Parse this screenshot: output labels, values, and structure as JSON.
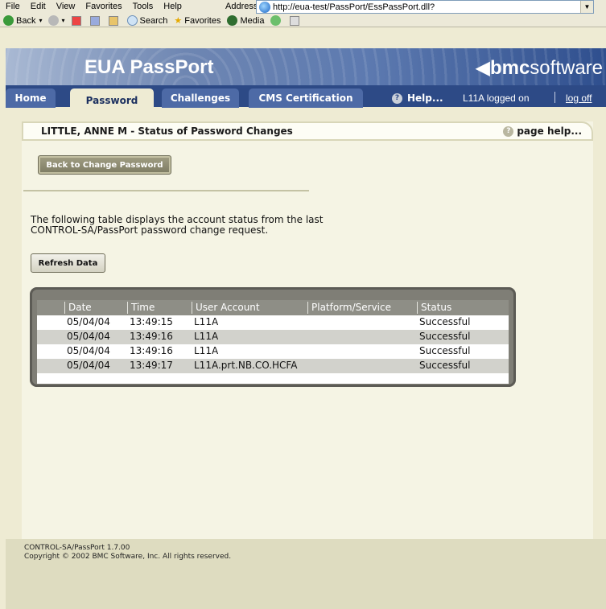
{
  "browser": {
    "menu": [
      "File",
      "Edit",
      "View",
      "Favorites",
      "Tools",
      "Help"
    ],
    "address_label": "Address",
    "url": "http://eua-test/PassPort/EssPassPort.dll?",
    "toolbar": {
      "back": "Back",
      "search": "Search",
      "favorites": "Favorites",
      "media": "Media"
    }
  },
  "header": {
    "product_title": "EUA  PassPort",
    "brand_bold": "bmc",
    "brand_rest": "software"
  },
  "nav": {
    "tabs": [
      {
        "label": "Home"
      },
      {
        "label": "Password",
        "active": true
      },
      {
        "label": "Challenges"
      },
      {
        "label": "CMS Certification"
      }
    ],
    "help": "Help...",
    "logged_on": "L11A logged on",
    "log_off": "log off"
  },
  "panel": {
    "title": "LITTLE, ANNE M - Status of Password Changes",
    "page_help": "page help...",
    "back_button": "Back to Change Password",
    "intro": "The following table displays the account status from the last CONTROL-SA/PassPort password change request.",
    "refresh_button": "Refresh Data"
  },
  "table": {
    "columns": [
      "Date",
      "Time",
      "User Account",
      "Platform/Service",
      "Status"
    ],
    "rows": [
      [
        "05/04/04",
        "13:49:15",
        "L11A",
        "",
        "Successful"
      ],
      [
        "05/04/04",
        "13:49:16",
        "L11A",
        "",
        "Successful"
      ],
      [
        "05/04/04",
        "13:49:16",
        "L11A",
        "",
        "Successful"
      ],
      [
        "05/04/04",
        "13:49:17",
        "L11A.prt.NB.CO.HCFA",
        "",
        "Successful"
      ]
    ]
  },
  "footer": {
    "version": "CONTROL-SA/PassPort 1.7.00",
    "copyright": "Copyright © 2002 BMC Software, Inc. All rights reserved."
  },
  "colors": {
    "nav_blue": "#2d4a86",
    "page_beige": "#eeebd3"
  }
}
